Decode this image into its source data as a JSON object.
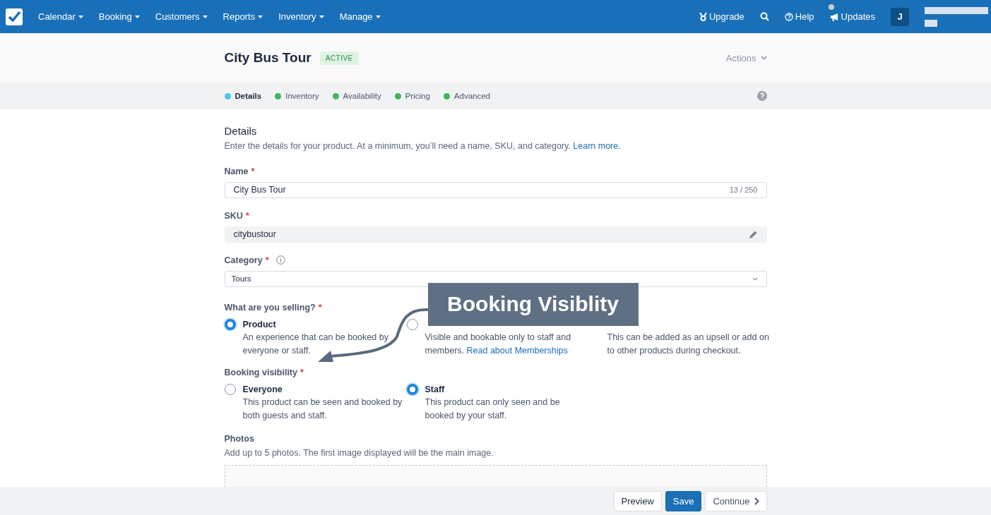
{
  "nav": {
    "menus": [
      {
        "label": "Calendar"
      },
      {
        "label": "Booking"
      },
      {
        "label": "Customers"
      },
      {
        "label": "Reports"
      },
      {
        "label": "Inventory"
      },
      {
        "label": "Manage"
      }
    ],
    "upgrade": "Upgrade",
    "help": "Help",
    "updates": "Updates",
    "avatar": "J"
  },
  "header": {
    "title": "City Bus Tour",
    "badge": "ACTIVE",
    "actions": "Actions"
  },
  "steps": [
    {
      "label": "Details",
      "selected": true,
      "color": "#4fc3f7"
    },
    {
      "label": "Inventory",
      "selected": false,
      "color": "#3cb95a"
    },
    {
      "label": "Availability",
      "selected": false,
      "color": "#3cb95a"
    },
    {
      "label": "Pricing",
      "selected": false,
      "color": "#3cb95a"
    },
    {
      "label": "Advanced",
      "selected": false,
      "color": "#3cb95a"
    }
  ],
  "details": {
    "title": "Details",
    "intro": "Enter the details for your product. At a minimum, you’ll need a name, SKU, and category.",
    "intro_link": "Learn more",
    "intro_end": "."
  },
  "name": {
    "label": "Name",
    "required_mark": "*",
    "value": "City Bus Tour",
    "count": "13 / 250"
  },
  "sku": {
    "label": "SKU",
    "required_mark": "*",
    "value": "citybustour"
  },
  "category": {
    "label": "Category",
    "required_mark": "*",
    "value": "Tours"
  },
  "selling": {
    "label": "What are you selling?",
    "required_mark": "*",
    "options": [
      {
        "title": "Product",
        "text": "An experience that can be booked by everyone or staff.",
        "selected": true
      },
      {
        "text": "Visible and bookable only to staff and members.",
        "link": "Read about Memberships",
        "selected": false
      },
      {
        "text": "This can be added as an upsell or add on to other products during checkout."
      }
    ]
  },
  "visibility": {
    "label": "Booking visibility",
    "required_mark": "*",
    "options": [
      {
        "title": "Everyone",
        "text": "This product can be seen and booked by both guests and staff.",
        "selected": false
      },
      {
        "title": "Staff",
        "text": "This product can only seen and be booked by your staff.",
        "selected": true
      }
    ]
  },
  "photos": {
    "label": "Photos",
    "hint": "Add up to 5 photos. The first image displayed will be the main image."
  },
  "annotation": "Booking Visiblity",
  "footer": {
    "buttons": [
      {
        "label": "Preview",
        "kind": "secondary"
      },
      {
        "label": "Save",
        "kind": "primary"
      },
      {
        "label": "Continue",
        "kind": "next"
      }
    ]
  }
}
